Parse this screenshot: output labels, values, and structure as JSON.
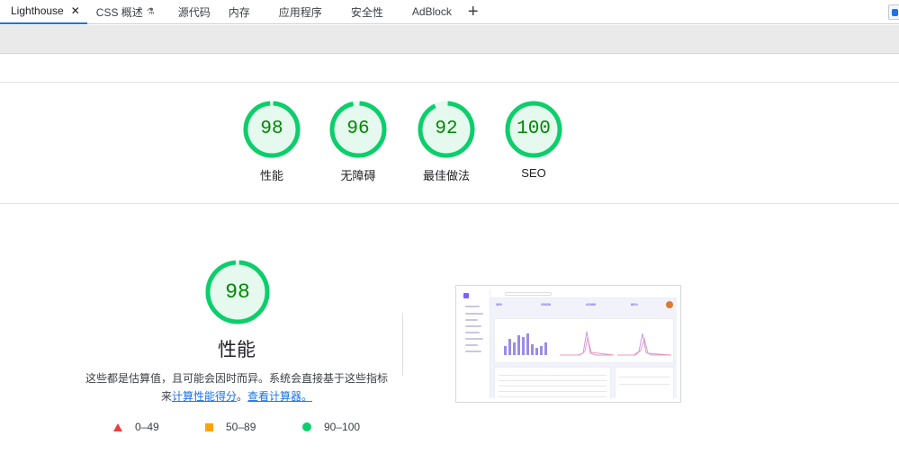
{
  "tabs": [
    {
      "label": "Lighthouse",
      "active": true,
      "close": "✕"
    },
    {
      "label": "CSS 概述",
      "flask": "⚗"
    },
    {
      "label": "源代码"
    },
    {
      "label": "内存"
    },
    {
      "label": "应用程序"
    },
    {
      "label": "安全性"
    },
    {
      "label": "AdBlock"
    }
  ],
  "add_tab_glyph": "+",
  "scores": [
    {
      "value": "98",
      "label": "性能"
    },
    {
      "value": "96",
      "label": "无障碍"
    },
    {
      "value": "92",
      "label": "最佳做法"
    },
    {
      "value": "100",
      "label": "SEO"
    }
  ],
  "performance": {
    "score": "98",
    "title": "性能",
    "desc_prefix": "这些都是估算值，且可能会因时而异。系统会直接基于这些指标来",
    "link1": "计算性能得分",
    "sep": "。",
    "link2": "查看计算器。"
  },
  "legend": [
    {
      "label": "0–49",
      "shape": "triangle",
      "color": "#e9403b"
    },
    {
      "label": "50–89",
      "shape": "square",
      "color": "#ffa400"
    },
    {
      "label": "90–100",
      "shape": "circle",
      "color": "#0cce6b"
    }
  ],
  "colors": {
    "pass": "#0cce6b",
    "pass_bg": "#e5f9ef",
    "score_text": "#008800",
    "link": "#1a73e8"
  },
  "thumbnail": {
    "stats": [
      "389",
      "25830",
      "42880",
      "86%"
    ]
  }
}
